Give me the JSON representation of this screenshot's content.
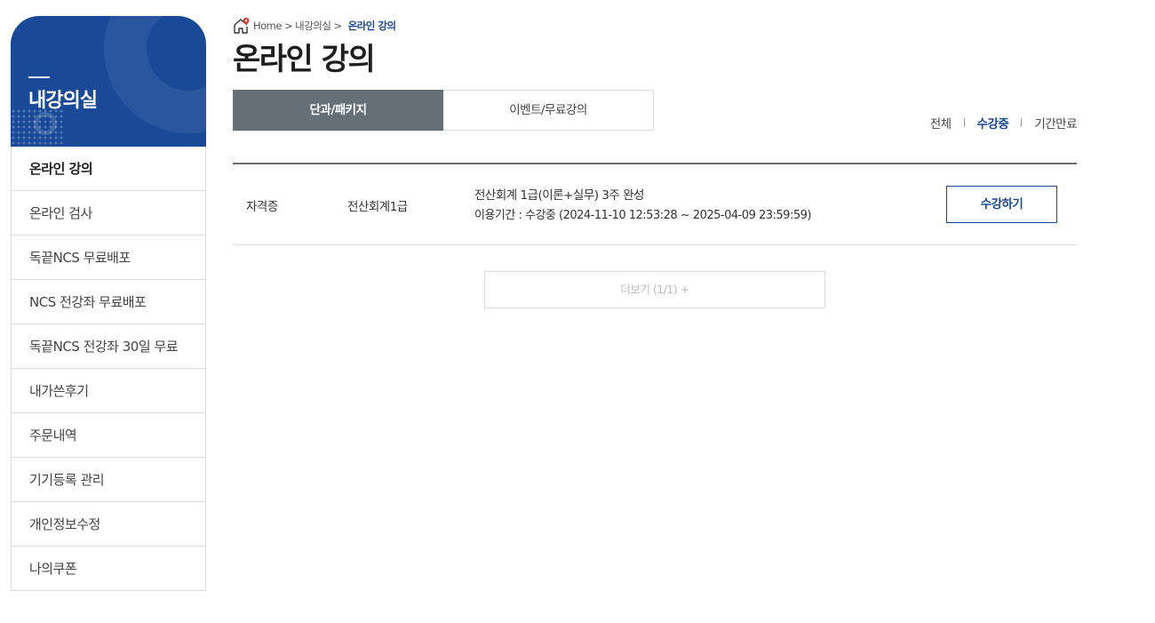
{
  "sidebar": {
    "title": "내강의실",
    "items": [
      {
        "label": "온라인 강의",
        "active": true
      },
      {
        "label": "온라인 검사"
      },
      {
        "label": "독끝NCS 무료배포"
      },
      {
        "label": "NCS 전강좌 무료배포"
      },
      {
        "label": "독끝NCS 전강좌 30일 무료"
      },
      {
        "label": "내가쓴후기"
      },
      {
        "label": "주문내역"
      },
      {
        "label": "기기등록 관리"
      },
      {
        "label": "개인정보수정"
      },
      {
        "label": "나의쿠폰"
      }
    ],
    "brand_color": "#1a4a97"
  },
  "breadcrumb": {
    "home": "Home",
    "parent": "내강의실",
    "current": "온라인 강의",
    "home_icon": "home-pin-icon"
  },
  "page": {
    "title": "온라인 강의"
  },
  "tabs": [
    {
      "label": "단과/패키지",
      "active": true
    },
    {
      "label": "이벤트/무료강의",
      "active": false
    }
  ],
  "filters": [
    {
      "label": "전체",
      "active": false
    },
    {
      "label": "수강중",
      "active": true
    },
    {
      "label": "기간만료",
      "active": false
    }
  ],
  "courses": [
    {
      "category": "자격증",
      "subject": "전산회계1급",
      "title": "전산회계 1급(이론+실무) 3주 완성",
      "period": "이용기간 : 수강중 (2024-11-10 12:53:28 ~ 2025-04-09 23:59:59)",
      "button": "수강하기"
    }
  ],
  "more": {
    "label": "더보기 (1/1) +"
  },
  "colors": {
    "accent": "#1a4a97",
    "tab_active": "#656f78",
    "home_pin": "#e03a2f"
  }
}
